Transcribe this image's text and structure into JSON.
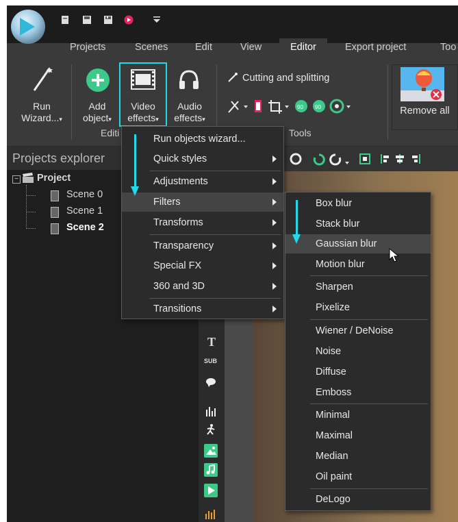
{
  "menu_tabs": [
    "Projects",
    "Scenes",
    "Edit",
    "View",
    "Editor",
    "Export project",
    "Too"
  ],
  "ribbon": {
    "run_wizard": [
      "Run",
      "Wizard..."
    ],
    "add_object": [
      "Add",
      "object"
    ],
    "video_effects": [
      "Video",
      "effects"
    ],
    "audio_effects": [
      "Audio",
      "effects"
    ],
    "cutting_splitting": "Cutting and splitting",
    "remove_all": "Remove all",
    "group_editing": "Editi",
    "group_tools": "Tools"
  },
  "left_panel": {
    "title": "Projects explorer",
    "project": "Project",
    "scenes": [
      "Scene 0",
      "Scene 1",
      "Scene 2"
    ]
  },
  "video_effects_menu": [
    {
      "label": "Run objects wizard...",
      "submenu": false
    },
    {
      "label": "Quick styles",
      "submenu": true
    },
    {
      "label": "Adjustments",
      "submenu": true
    },
    {
      "label": "Filters",
      "submenu": true,
      "highlighted": true
    },
    {
      "label": "Transforms",
      "submenu": true
    },
    {
      "label": "Transparency",
      "submenu": true
    },
    {
      "label": "Special FX",
      "submenu": true
    },
    {
      "label": "360 and 3D",
      "submenu": true
    },
    {
      "label": "Transitions",
      "submenu": true
    }
  ],
  "filters_submenu": [
    "Box blur",
    "Stack blur",
    "Gaussian blur",
    "Motion blur",
    "Sharpen",
    "Pixelize",
    "Wiener / DeNoise",
    "Noise",
    "Diffuse",
    "Emboss",
    "Minimal",
    "Maximal",
    "Median",
    "Oil paint",
    "DeLogo"
  ],
  "vertical_tools": [
    "T",
    "SUB"
  ],
  "colors": {
    "accent": "#22d8ea",
    "background": "#3a3a3a",
    "menu": "#2b2b2b"
  }
}
